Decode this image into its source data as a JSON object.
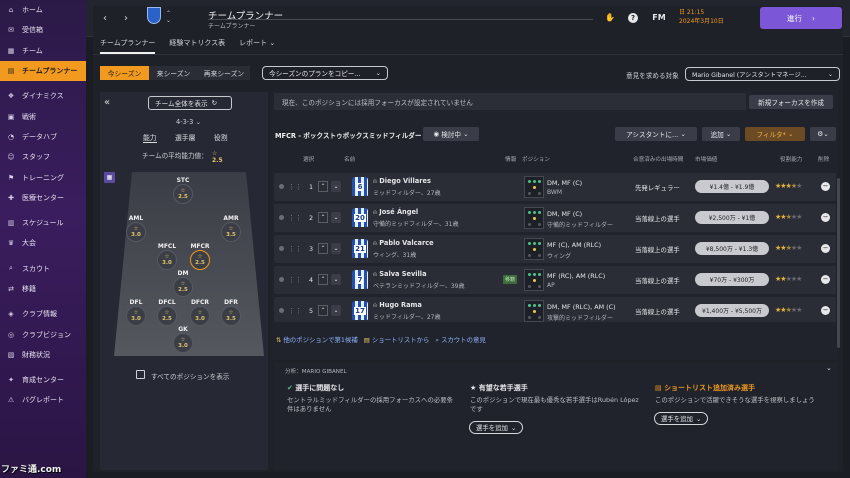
{
  "sidebar": {
    "items": [
      {
        "label": "ホーム",
        "icon": "home-icon",
        "glyph": "⌂"
      },
      {
        "label": "受信箱",
        "icon": "inbox-icon",
        "glyph": "✉"
      },
      {
        "label": "チーム",
        "icon": "team-icon",
        "glyph": "▦"
      },
      {
        "label": "チームプランナー",
        "icon": "planner-icon",
        "glyph": "▤",
        "active": true
      },
      {
        "label": "ダイナミクス",
        "icon": "dynamics-icon",
        "glyph": "❖"
      },
      {
        "label": "戦術",
        "icon": "tactics-icon",
        "glyph": "▣"
      },
      {
        "label": "データハブ",
        "icon": "datahub-icon",
        "glyph": "◔"
      },
      {
        "label": "スタッフ",
        "icon": "staff-icon",
        "glyph": "☺"
      },
      {
        "label": "トレーニング",
        "icon": "training-icon",
        "glyph": "⚑"
      },
      {
        "label": "医療センター",
        "icon": "medical-icon",
        "glyph": "✚"
      },
      {
        "label": "スケジュール",
        "icon": "schedule-icon",
        "glyph": "▥"
      },
      {
        "label": "大会",
        "icon": "trophy-icon",
        "glyph": "♛"
      },
      {
        "label": "スカウト",
        "icon": "scout-icon",
        "glyph": "⌕"
      },
      {
        "label": "移籍",
        "icon": "transfer-icon",
        "glyph": "⇄"
      },
      {
        "label": "クラブ情報",
        "icon": "club-info-icon",
        "glyph": "◈"
      },
      {
        "label": "クラブビジョン",
        "icon": "vision-icon",
        "glyph": "◎"
      },
      {
        "label": "財務状況",
        "icon": "finance-icon",
        "glyph": "▧"
      },
      {
        "label": "育成センター",
        "icon": "youth-icon",
        "glyph": "✦"
      },
      {
        "label": "バグレポート",
        "icon": "bug-icon",
        "glyph": "⚠"
      }
    ]
  },
  "header": {
    "title": "チームプランナー",
    "subtitle": "チームプランナー",
    "fm_label": "FM",
    "date_line1": "日 21:15",
    "date_line2": "2024年3月10日",
    "proceed_label": "進行"
  },
  "subtabs": [
    "チームプランナー",
    "経験マトリクス表",
    "レポート"
  ],
  "season_tabs": [
    "今シーズン",
    "来シーズン",
    "再来シーズン"
  ],
  "copy_plan_label": "今シーズンのプランをコピー...",
  "opinion_label": "意見を求める対象",
  "opinion_value": "Mario Gibanel (アシスタントマネージ...",
  "left": {
    "show_team": "チーム全体を表示",
    "formation": "4-3-3",
    "tabs": [
      "能力",
      "選手層",
      "役割"
    ],
    "avg_label": "チームの平均能力値：",
    "avg_value": "2.5",
    "show_all": "すべてのポジションを表示",
    "positions": [
      {
        "code": "STC",
        "rating": "2.5"
      },
      {
        "code": "AML",
        "rating": "3.0"
      },
      {
        "code": "AMR",
        "rating": "3.5"
      },
      {
        "code": "MFCL",
        "rating": "3.0"
      },
      {
        "code": "MFCR",
        "rating": "2.5"
      },
      {
        "code": "DM",
        "rating": "2.5"
      },
      {
        "code": "DFL",
        "rating": "3.0"
      },
      {
        "code": "DFCL",
        "rating": "2.5"
      },
      {
        "code": "DFCR",
        "rating": "3.0"
      },
      {
        "code": "DFR",
        "rating": "3.5"
      },
      {
        "code": "GK",
        "rating": "3.0"
      }
    ]
  },
  "main": {
    "info_text": "現在、このポジションには採用フォーカスが設定されていません",
    "new_focus": "新規フォーカスを作成",
    "position_title": "MFCR - ボックストゥボックスミッドフィルダー",
    "review_label": "検討中",
    "assistant_btn": "アシスタントに...",
    "add_btn": "追加",
    "filter_btn": "フィルタ*",
    "col_headers": [
      "選択",
      "名前",
      "情報",
      "ポジション",
      "合意済みの出場時間",
      "市場価値",
      "役割能力",
      "削除"
    ],
    "rows": [
      {
        "num": "1",
        "shirt": "6",
        "name": "Diego Villares",
        "sub": "ミッドフィルダー、27歳",
        "pos": "DM, MF (C)",
        "role": "BWM",
        "time": "先発レギュラー",
        "value": "¥1.4億 - ¥1.9億",
        "stars": 3.5
      },
      {
        "num": "2",
        "shirt": "20",
        "name": "José Ángel",
        "sub": "守備的ミッドフィルダー、31歳",
        "pos": "DM, MF (C)",
        "role": "守備的ミッドフィルダー",
        "time": "当落線上の選手",
        "value": "¥2,500万 - ¥1億",
        "stars": 2.5
      },
      {
        "num": "3",
        "shirt": "21",
        "name": "Pablo Valcarce",
        "sub": "ウィング、31歳",
        "pos": "MF (C), AM (RLC)",
        "role": "ウィング",
        "time": "当落線上の選手",
        "value": "¥8,500万 - ¥1.3億",
        "stars": 2.5
      },
      {
        "num": "4",
        "shirt": "7",
        "name": "Salva Sevilla",
        "sub": "ベテランミッドフィルダー、39歳",
        "pos": "MF (RC), AM (RLC)",
        "role": "AP",
        "time": "当落線上の選手",
        "value": "¥70万 - ¥300万",
        "stars": 2,
        "badge": "移籍"
      },
      {
        "num": "5",
        "shirt": "17",
        "name": "Hugo Rama",
        "sub": "ミッドフィルダー、27歳",
        "pos": "DM, MF (RLC), AM (C)",
        "role": "攻撃的ミッドフィルダー",
        "time": "当落線上の選手",
        "value": "¥1,400万 - ¥5,500万",
        "stars": 2.5
      }
    ],
    "footer_links": [
      "他のポジションで第1候補",
      "ショートリストから",
      "スカウトの意見"
    ]
  },
  "analysis": {
    "header": "分析：MARIO GIBANEL",
    "cards": [
      {
        "title": "選手に問題なし",
        "body": "セントラルミッドフィルダーの採用フォーカスへの必要条件はありません",
        "icon": "person-check-icon"
      },
      {
        "title": "有望な若手選手",
        "body": "このポジションで現在最も優秀な若手選手はRubén Lópezです",
        "button": "選手を追加",
        "icon": "star-icon"
      },
      {
        "title": "ショートリスト追加済み選手",
        "body": "このポジションで活躍できそうな選手を視察しましょう",
        "button": "選手を追加",
        "icon": "shortlist-icon"
      }
    ]
  },
  "watermark": "ファミ通.com"
}
